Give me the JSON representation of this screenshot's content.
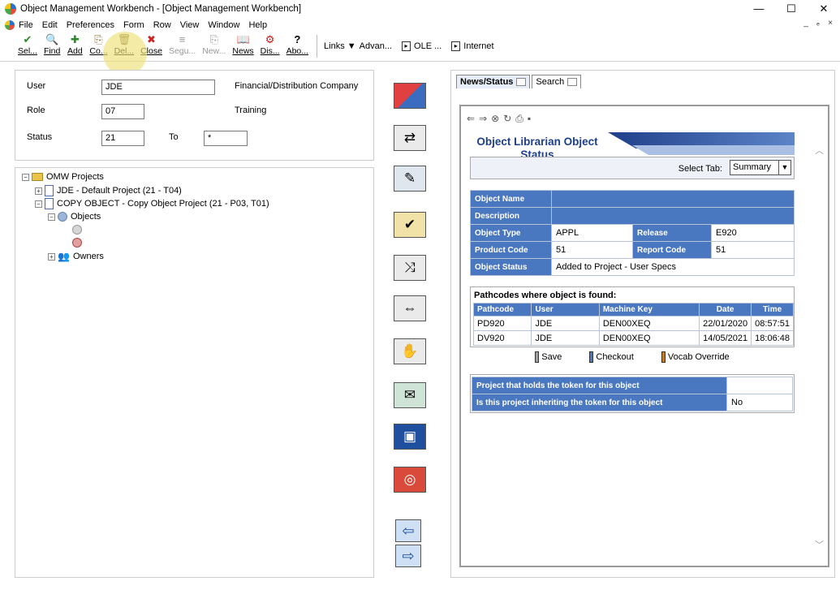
{
  "window": {
    "title": "Object Management Workbench - [Object Management Workbench]",
    "controls": [
      "—",
      "☐",
      "✕"
    ],
    "mdi_controls": [
      "_",
      "ₑ",
      "×"
    ]
  },
  "menu": [
    "File",
    "Edit",
    "Preferences",
    "Form",
    "Row",
    "View",
    "Window",
    "Help"
  ],
  "toolbar": {
    "buttons": [
      {
        "label": "Sel...",
        "icon": "✔"
      },
      {
        "label": "Find",
        "icon": "🔍"
      },
      {
        "label": "Add",
        "icon": "✚"
      },
      {
        "label": "Co...",
        "icon": "⎘"
      },
      {
        "label": "Del...",
        "icon": "🗑"
      },
      {
        "label": "Close",
        "icon": "✖"
      },
      {
        "label": "Segu...",
        "icon": "≡"
      },
      {
        "label": "New...",
        "icon": "⎘"
      },
      {
        "label": "News",
        "icon": "📖"
      },
      {
        "label": "Dis...",
        "icon": "⚙"
      },
      {
        "label": "Abo...",
        "icon": "?"
      }
    ],
    "links_label": "Links",
    "advan_label": "Advan...",
    "ole_label": "OLE ...",
    "internet_label": "Internet"
  },
  "header_form": {
    "user_label": "User",
    "user_value": "JDE",
    "user_desc": "Financial/Distribution Company",
    "role_label": "Role",
    "role_value": "07",
    "role_desc": "Training",
    "status_label": "Status",
    "status_value": "21",
    "to_label": "To",
    "to_value": "*"
  },
  "tree": {
    "root": "OMW Projects",
    "project1": "JDE - Default Project (21 - T04)",
    "project2": "COPY OBJECT - Copy Object Project (21 - P03, T01)",
    "objects": "Objects",
    "owners": "Owners"
  },
  "tabs": {
    "news_status": "News/Status",
    "search": "Search"
  },
  "object_status": {
    "title": "Object Librarian Object Status",
    "select_tab_label": "Select Tab:",
    "select_tab_value": "Summary",
    "object_name_label": "Object Name",
    "object_name_value": "",
    "description_label": "Description",
    "description_value": "",
    "object_type_label": "Object Type",
    "object_type_value": "APPL",
    "release_label": "Release",
    "release_value": "E920",
    "product_code_label": "Product Code",
    "product_code_value": "51",
    "report_code_label": "Report Code",
    "report_code_value": "51",
    "object_status_label": "Object Status",
    "object_status_value": "Added to Project - User Specs"
  },
  "pathcodes": {
    "title": "Pathcodes where object is found:",
    "columns": [
      "Pathcode",
      "User",
      "Machine Key",
      "Date",
      "Time"
    ],
    "rows": [
      [
        "PD920",
        "JDE",
        "DEN00XEQ",
        "22/01/2020",
        "08:57:51"
      ],
      [
        "DV920",
        "JDE",
        "DEN00XEQ",
        "14/05/2021",
        "18:06:48"
      ]
    ],
    "legend": [
      {
        "label": "Save",
        "color": "#a0a0a0"
      },
      {
        "label": "Checkout",
        "color": "#4a78c0"
      },
      {
        "label": "Vocab Override",
        "color": "#c07a2a"
      }
    ]
  },
  "token": {
    "holds_label": "Project that holds the token for this object",
    "holds_value": "",
    "inherit_label": "Is this project inheriting the token for this object",
    "inherit_value": "No"
  }
}
